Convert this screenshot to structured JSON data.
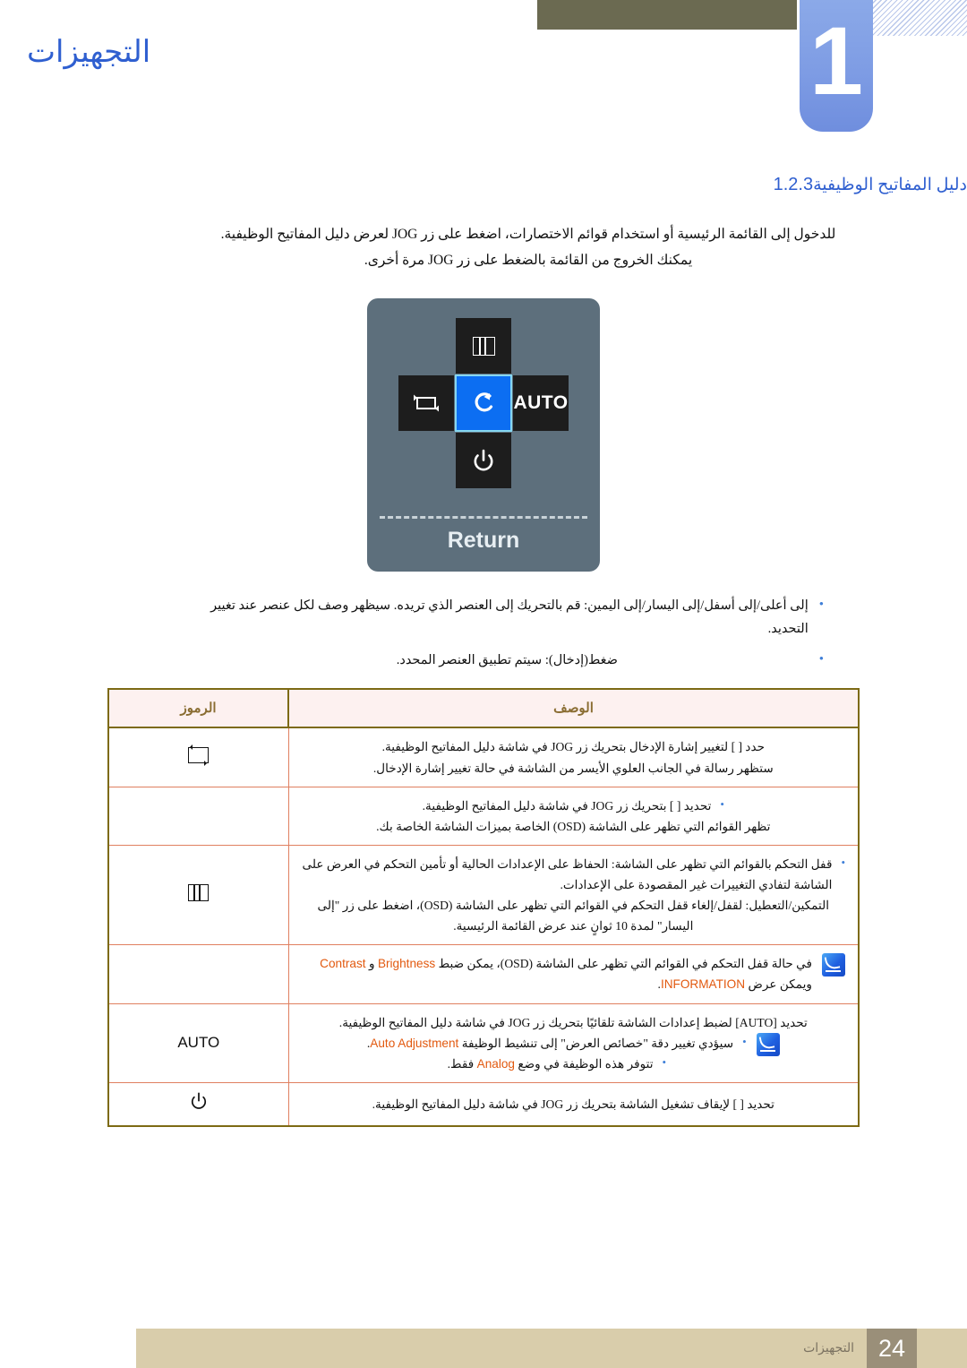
{
  "header": {
    "chapter_number": "1",
    "chapter_title": "التجهيزات"
  },
  "section": {
    "number": "1.2.3",
    "name": "دليل المفاتيح الوظيفية"
  },
  "intro": {
    "line1": "للدخول إلى القائمة الرئيسية أو استخدام قوائم الاختصارات، اضغط على زر JOG لعرض دليل المفاتيح الوظيفية.",
    "line2": "يمكنك الخروج من القائمة بالضغط على زر JOG مرة أخرى."
  },
  "jog_diagram": {
    "up_icon": "menu-bars-icon",
    "left_icon": "source-loop-icon",
    "center_icon": "return-arrow-icon",
    "right_label": "AUTO",
    "down_icon": "power-icon",
    "caption": "Return"
  },
  "bullets": [
    "إلى أعلى/إلى أسفل/إلى اليسار/إلى اليمين: قم بالتحريك إلى العنصر الذي تريده. سيظهر وصف لكل عنصر عند تغيير التحديد.",
    "ضغط(إدخال): سيتم تطبيق العنصر المحدد."
  ],
  "table": {
    "headers": {
      "description": "الوصف",
      "symbols": "الرموز"
    },
    "rows": [
      {
        "symbol": "source-loop-icon",
        "symbol_text": "",
        "lines": [
          "حدد [ ] لتغيير إشارة الإدخال بتحريك زر JOG في شاشة دليل المفاتيح الوظيفية.",
          "ستظهر رسالة في الجانب العلوي الأيسر من الشاشة في حالة تغيير إشارة الإدخال."
        ]
      },
      {
        "symbol": "menu-bars-icon",
        "symbol_text": "",
        "bullet_line": "تحديد [ ] بتحريك زر JOG في شاشة دليل المفاتيح الوظيفية.",
        "lines": [
          "تظهر القوائم التي تظهر على الشاشة (OSD) الخاصة بميزات الشاشة الخاصة بك."
        ]
      },
      {
        "symbol": "menu-bars-icon",
        "symbol_text": "",
        "bullet_line": "قفل التحكم بالقوائم التي تظهر على الشاشة: الحفاظ على الإعدادات الحالية أو تأمين التحكم في العرض على الشاشة لتفادي التغييرات غير المقصودة على الإعدادات.",
        "lines": [
          "التمكين/التعطيل: لقفل/إلغاء قفل التحكم في القوائم التي تظهر على الشاشة (OSD)، اضغط على زر \"إلى اليسار\" لمدة 10 ثوانٍ عند عرض القائمة الرئيسية."
        ]
      },
      {
        "symbol": "note-icon",
        "symbol_text": "",
        "note_prefix": "في حالة قفل التحكم في القوائم التي تظهر على الشاشة (OSD)، يمكن ضبط",
        "note_keywords": [
          "Brightness",
          "Contrast",
          "INFORMATION"
        ],
        "note_mid": "و",
        "note_suffix": "ويمكن عرض",
        "note_end": "."
      },
      {
        "symbol": "auto-label",
        "symbol_text": "AUTO",
        "lines": [
          "تحديد [AUTO] لضبط إعدادات الشاشة تلقائيًا بتحريك زر JOG في شاشة دليل المفاتيح الوظيفية."
        ],
        "note_bullets": [
          {
            "before": "سيؤدي تغيير دقة \"خصائص العرض\" إلى تنشيط الوظيفة",
            "keyword": "Auto Adjustment",
            "after": "."
          },
          {
            "before": "تتوفر هذه الوظيفة في وضع",
            "keyword": "Analog",
            "after": "فقط."
          }
        ]
      },
      {
        "symbol": "power-icon",
        "symbol_text": "",
        "lines": [
          "تحديد [ ] لإيقاف تشغيل الشاشة بتحريك زر JOG في شاشة دليل المفاتيح الوظيفية."
        ]
      }
    ]
  },
  "footer": {
    "label": "التجهيزات",
    "page_number": "24"
  }
}
